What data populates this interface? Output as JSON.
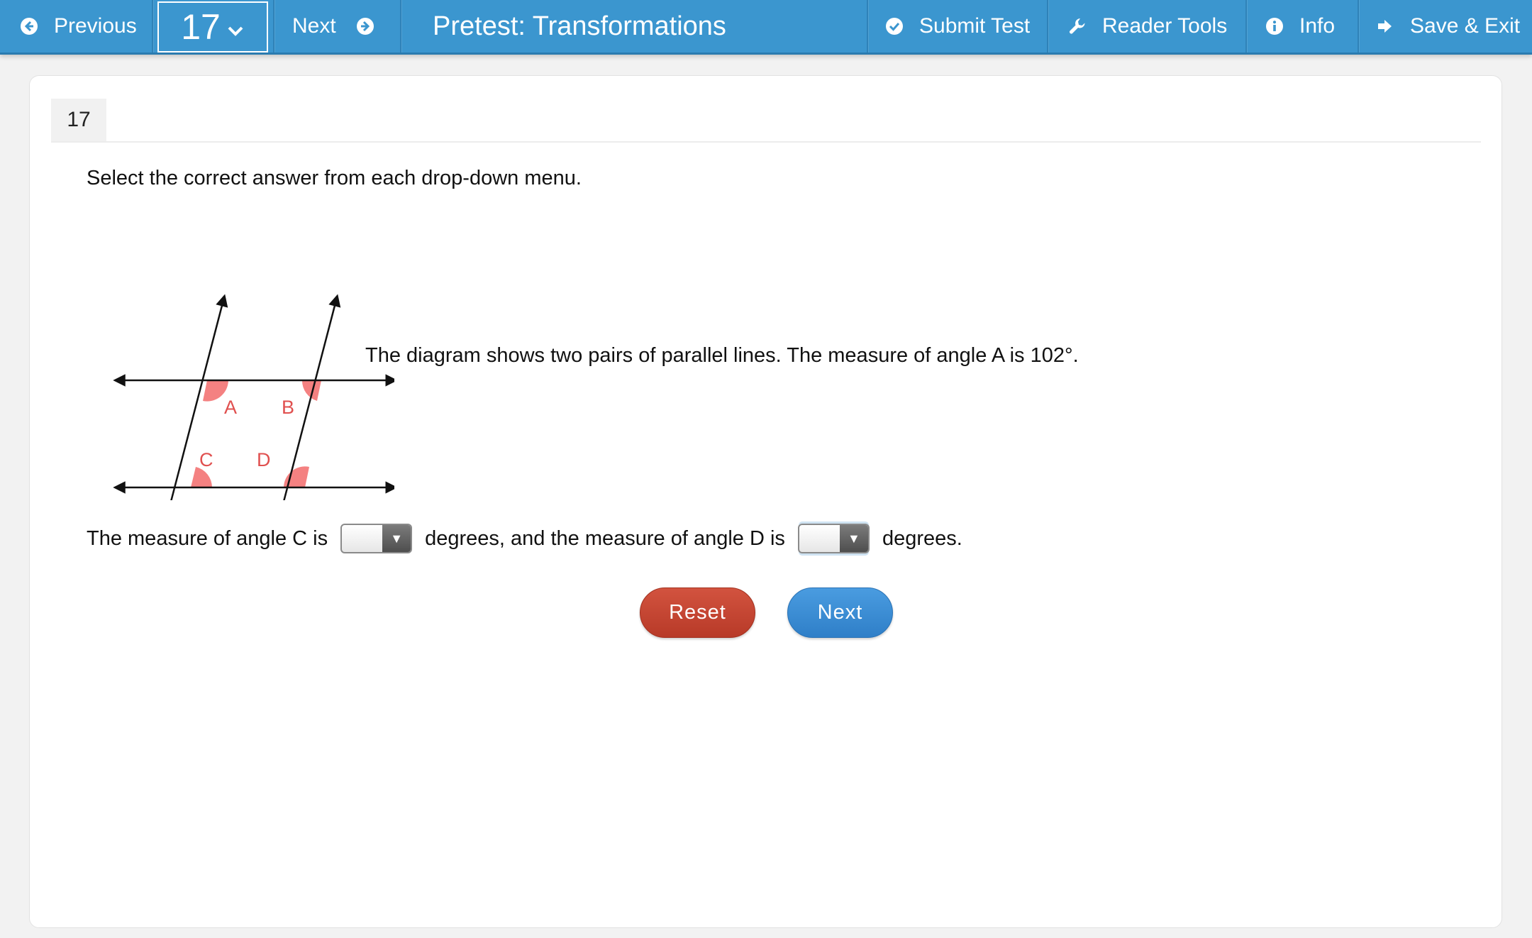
{
  "toolbar": {
    "previous_label": "Previous",
    "question_number": "17",
    "next_label": "Next",
    "title": "Pretest: Transformations",
    "submit_label": "Submit Test",
    "reader_tools_label": "Reader Tools",
    "info_label": "Info",
    "save_exit_label": "Save & Exit",
    "icons": {
      "previous": "arrow-left-circle-icon",
      "question_menu": "chevron-down-icon",
      "next": "arrow-right-circle-icon",
      "submit": "check-circle-icon",
      "reader_tools": "wrench-icon",
      "info": "info-circle-icon",
      "save_exit": "sign-out-icon"
    },
    "color": "#3b96cf"
  },
  "question": {
    "number_tab": "17",
    "instruction": "Select the correct answer from each drop-down menu.",
    "statement": "The diagram shows two pairs of parallel lines. The measure of angle A is 102°.",
    "diagram_labels": {
      "a": "A",
      "b": "B",
      "c": "C",
      "d": "D"
    },
    "answer_part1": "The measure of angle C is",
    "answer_part2": "degrees, and the measure of angle D is",
    "answer_part3": "degrees.",
    "dropdown_c_value": "",
    "dropdown_d_value": "",
    "angle_color": "#f26b6b"
  },
  "buttons": {
    "reset_label": "Reset",
    "next_label": "Next",
    "reset_color": "#c4442f",
    "next_color": "#3a8bd4"
  }
}
